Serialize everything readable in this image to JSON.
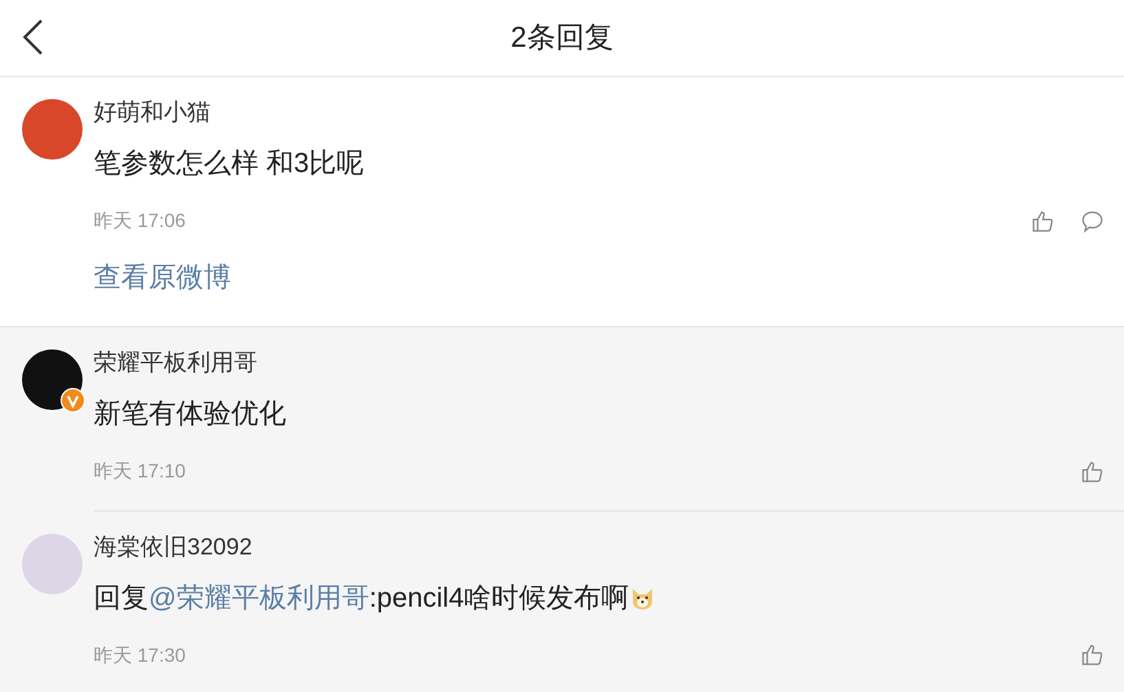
{
  "header": {
    "title": "2条回复"
  },
  "main_comment": {
    "author": "好萌和小猫",
    "text_parts": [
      {
        "kind": "plain",
        "text": "笔参数怎么样 和3比呢"
      }
    ],
    "time": "昨天 17:06",
    "verified": false,
    "emoji": false,
    "commentable": true,
    "link": "查看原微博"
  },
  "replies": [
    {
      "author": "荣耀平板利用哥",
      "text_parts": [
        {
          "kind": "plain",
          "text": "新笔有体验优化"
        }
      ],
      "time": "昨天 17:10",
      "verified": true,
      "emoji": false,
      "commentable": false
    },
    {
      "author": "海棠依旧32092",
      "text_parts": [
        {
          "kind": "plain",
          "text": "回复"
        },
        {
          "kind": "mention",
          "text": "@荣耀平板利用哥"
        },
        {
          "kind": "plain",
          "text": ":pencil4啥时候发布啊"
        }
      ],
      "time": "昨天 17:30",
      "verified": false,
      "emoji": true,
      "commentable": false
    }
  ]
}
